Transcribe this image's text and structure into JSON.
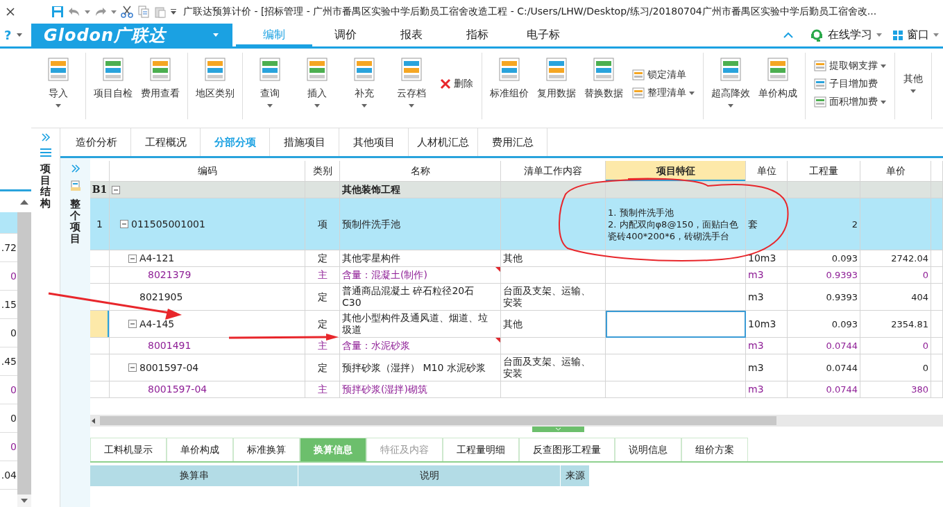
{
  "title_bar": {
    "title": "广联达预算计价 - [招标管理 - 广州市番禺区实验中学后勤员工宿舍改造工程 - C:/Users/LHW/Desktop/练习/20180704广州市番禺区实验中学后勤员工宿舍改..."
  },
  "help_menu": {
    "label": "?"
  },
  "logo": {
    "text": "Glodon广联达"
  },
  "ribbon_tabs": [
    {
      "label": "编制",
      "selected": true
    },
    {
      "label": "调价",
      "selected": false
    },
    {
      "label": "报表",
      "selected": false
    },
    {
      "label": "指标",
      "selected": false
    },
    {
      "label": "电子标",
      "selected": false
    }
  ],
  "ribbon_right": {
    "learn": "在线学习",
    "window": "窗口"
  },
  "ribbon_groups": [
    {
      "items": [
        {
          "label": "导入",
          "kind": "large",
          "dropdown": true
        }
      ]
    },
    {
      "items": [
        {
          "label": "项目自检",
          "kind": "large",
          "dropdown": false
        },
        {
          "label": "费用查看",
          "kind": "large",
          "dropdown": false
        }
      ]
    },
    {
      "items": [
        {
          "label": "地区类别",
          "kind": "large",
          "dropdown": false
        }
      ]
    },
    {
      "items": [
        {
          "label": "查询",
          "kind": "large",
          "dropdown": true
        },
        {
          "label": "插入",
          "kind": "large",
          "dropdown": true
        },
        {
          "label": "补充",
          "kind": "large",
          "dropdown": true
        },
        {
          "label": "云存档",
          "kind": "large",
          "dropdown": true
        },
        {
          "label": "删除",
          "kind": "remove",
          "dropdown": false
        }
      ]
    },
    {
      "items": [
        {
          "label": "标准组价",
          "kind": "large",
          "dropdown": false
        },
        {
          "label": "复用数据",
          "kind": "large",
          "dropdown": false
        },
        {
          "label": "替换数据",
          "kind": "large",
          "dropdown": false
        },
        {
          "label": "锁定清单",
          "kind": "small",
          "dropdown": false
        },
        {
          "label": "整理清单",
          "kind": "small",
          "dropdown": true
        }
      ]
    },
    {
      "items": [
        {
          "label": "超高降效",
          "kind": "large",
          "dropdown": true
        },
        {
          "label": "单价构成",
          "kind": "large",
          "dropdown": false
        }
      ]
    },
    {
      "items": [
        {
          "label": "提取钢支撑",
          "kind": "small",
          "dropdown": true
        },
        {
          "label": "子目增加费",
          "kind": "small",
          "dropdown": false
        },
        {
          "label": "面积增加费",
          "kind": "small",
          "dropdown": true
        }
      ]
    },
    {
      "items": [
        {
          "label": "其他",
          "kind": "text",
          "dropdown": true
        }
      ]
    }
  ],
  "left_panel": {
    "rows": [
      {
        "selected": true
      },
      {
        "value": ".72",
        "kind": "normal",
        "selected": false
      },
      {
        "value": "0",
        "kind": "material",
        "selected": false
      },
      {
        "value": ".15",
        "kind": "normal",
        "selected": false
      },
      {
        "value": "0",
        "kind": "normal",
        "selected": false
      },
      {
        "value": ".45",
        "kind": "normal",
        "selected": false
      },
      {
        "value": "0",
        "kind": "material",
        "selected": false
      },
      {
        "value": "0",
        "kind": "normal",
        "selected": false
      },
      {
        "value": "0",
        "kind": "material",
        "selected": false
      },
      {
        "value": ".04",
        "kind": "normal",
        "selected": false
      }
    ]
  },
  "side_nav": {
    "label": "项目结构"
  },
  "view_tabs": [
    {
      "label": "造价分析",
      "selected": false
    },
    {
      "label": "工程概况",
      "selected": false
    },
    {
      "label": "分部分项",
      "selected": true
    },
    {
      "label": "措施项目",
      "selected": false
    },
    {
      "label": "其他项目",
      "selected": false
    },
    {
      "label": "人材机汇总",
      "selected": false
    },
    {
      "label": "费用汇总",
      "selected": false
    }
  ],
  "tree_nav": {
    "label": "整个项目"
  },
  "table": {
    "columns": [
      {
        "label": "编码",
        "selected": false
      },
      {
        "label": "类别",
        "selected": false
      },
      {
        "label": "名称",
        "selected": false
      },
      {
        "label": "清单工作内容",
        "selected": false
      },
      {
        "label": "项目特征",
        "selected": true
      },
      {
        "label": "单位",
        "selected": false
      },
      {
        "label": "工程量",
        "selected": false
      },
      {
        "label": "单价",
        "selected": false
      }
    ],
    "rows": [
      {
        "number": "B1",
        "name": "其他装饰工程",
        "kind": "section",
        "selected": false,
        "current": false,
        "flagged": false,
        "expanded": true,
        "children": [
          {
            "number": "1",
            "code": "011505001001",
            "type": "项",
            "name": "预制件洗手池",
            "features": "1. 预制件洗手池\n2. 内配双向φ8@150，面贴白色瓷砖400*200*6，砖砌洗手台",
            "unit": "套",
            "quantity": "2",
            "kind": "item",
            "selected": true,
            "current": false,
            "flagged": false,
            "expanded": true,
            "children": [
              {
                "code": "A4-121",
                "type": "定",
                "name": "其他零星构件",
                "work_content": "其他",
                "unit": "10m3",
                "quantity": "0.093",
                "unit_price": "2742.04",
                "kind": "quota",
                "selected": false,
                "current": false,
                "flagged": false,
                "expanded": true,
                "children": [
                  {
                    "code": "8021379",
                    "type": "主",
                    "name": "含量：混凝土(制作)",
                    "unit": "m3",
                    "quantity": "0.9393",
                    "unit_price": "0",
                    "kind": "material",
                    "selected": false,
                    "current": false,
                    "flagged": true
                  }
                ]
              },
              {
                "code": "8021905",
                "type": "定",
                "name": "普通商品混凝土 碎石粒径20石 C30",
                "work_content": "台面及支架、运输、安装",
                "unit": "m3",
                "quantity": "0.9393",
                "unit_price": "404",
                "kind": "quota",
                "selected": false,
                "current": false,
                "flagged": false
              },
              {
                "code": "A4-145",
                "type": "定",
                "name": "其他小型构件及通风道、烟道、垃圾道",
                "work_content": "其他",
                "unit": "10m3",
                "quantity": "0.093",
                "unit_price": "2354.81",
                "kind": "quota",
                "selected": false,
                "current": true,
                "flagged": false,
                "expanded": true,
                "children": [
                  {
                    "code": "8001491",
                    "type": "主",
                    "name": "含量：水泥砂浆",
                    "unit": "m3",
                    "quantity": "0.0744",
                    "unit_price": "0",
                    "kind": "material",
                    "selected": false,
                    "current": false,
                    "flagged": true
                  }
                ]
              },
              {
                "code": "8001597-04",
                "type": "定",
                "name": "预拌砂浆（湿拌） M10 水泥砂浆",
                "work_content": "台面及支架、运输、安装",
                "unit": "m3",
                "quantity": "0.0744",
                "unit_price": "0",
                "kind": "quota",
                "selected": false,
                "current": false,
                "flagged": false,
                "expanded": true,
                "children": [
                  {
                    "code": "8001597-04",
                    "type": "主",
                    "name": "预拌砂浆(湿拌)砌筑",
                    "unit": "m3",
                    "quantity": "0.0744",
                    "unit_price": "380",
                    "kind": "material",
                    "selected": false,
                    "current": false,
                    "flagged": false
                  }
                ]
              }
            ]
          }
        ]
      }
    ]
  },
  "bottom_tabs": [
    {
      "label": "工料机显示",
      "selected": false,
      "disabled": false
    },
    {
      "label": "单价构成",
      "selected": false,
      "disabled": false
    },
    {
      "label": "标准换算",
      "selected": false,
      "disabled": false
    },
    {
      "label": "换算信息",
      "selected": true,
      "disabled": false
    },
    {
      "label": "特征及内容",
      "selected": false,
      "disabled": true
    },
    {
      "label": "工程量明细",
      "selected": false,
      "disabled": false
    },
    {
      "label": "反查图形工程量",
      "selected": false,
      "disabled": false
    },
    {
      "label": "说明信息",
      "selected": false,
      "disabled": false
    },
    {
      "label": "组价方案",
      "selected": false,
      "disabled": false
    }
  ],
  "bottom_table": {
    "columns": [
      "换算串",
      "说明",
      "来源"
    ]
  }
}
